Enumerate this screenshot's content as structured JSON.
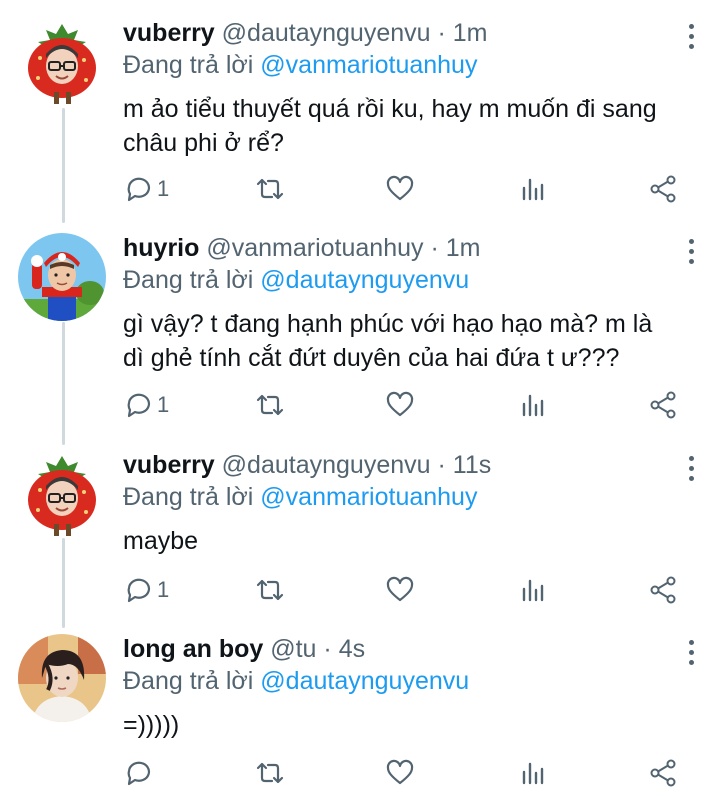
{
  "reply_prefix": "Đang trả lời",
  "tweets": [
    {
      "name": "vuberry",
      "handle": "@dautaynguyenvu",
      "separator": "·",
      "time": "1m",
      "reply_to": "@vanmariotuanhuy",
      "text_lines": [
        "m ảo tiểu thuyết quá rồi ku, hay m muốn đi sang",
        "châu phi ở rể?"
      ],
      "reply_count": "1",
      "avatar_icon": "strawberry-character-avatar"
    },
    {
      "name": "huyrio",
      "handle": "@vanmariotuanhuy",
      "separator": "·",
      "time": "1m",
      "reply_to": "@dautaynguyenvu",
      "text_lines": [
        "gì vậy? t đang hạnh phúc với hạo hạo mà? m là",
        "dì ghẻ tính cắt đứt duyên của hai đứa t ư???"
      ],
      "reply_count": "1",
      "avatar_icon": "mario-character-avatar"
    },
    {
      "name": "vuberry",
      "handle": "@dautaynguyenvu",
      "separator": "·",
      "time": "11s",
      "reply_to": "@vanmariotuanhuy",
      "text_lines": [
        "maybe"
      ],
      "reply_count": "1",
      "avatar_icon": "strawberry-character-avatar"
    },
    {
      "name": "long an boy",
      "handle": "@tu",
      "separator": "·",
      "time": "4s",
      "reply_to": "@dautaynguyenvu",
      "text_lines": [
        "=)))))"
      ],
      "reply_count": "",
      "avatar_icon": "person-photo-avatar"
    }
  ],
  "icons": {
    "reply": "reply-icon",
    "retweet": "retweet-icon",
    "like": "like-icon",
    "views": "views-icon",
    "share": "share-icon",
    "more": "more-icon"
  },
  "colors": {
    "text": "#0f1419",
    "secondary": "#536471",
    "mention": "#1d9bf0",
    "thread_line": "#cfd9de"
  }
}
